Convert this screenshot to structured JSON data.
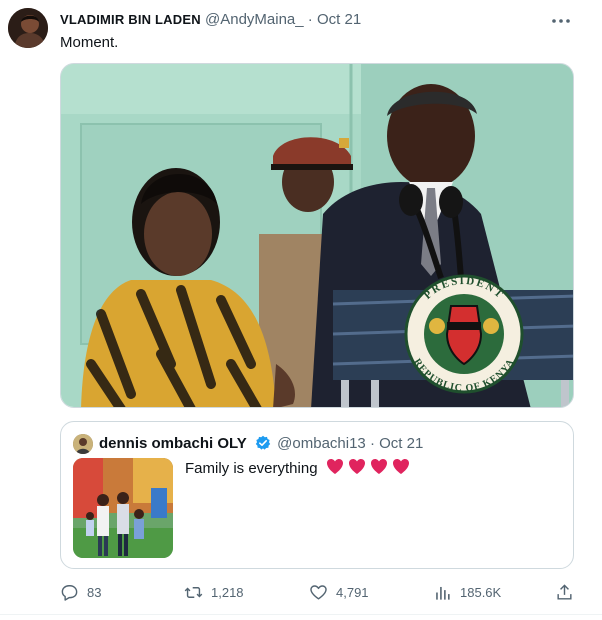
{
  "tweet": {
    "display_name": "VLADIMIR BIN LADEN",
    "handle": "@AndyMaina_",
    "separator": "·",
    "date": "Oct 21",
    "text": "Moment.",
    "more_icon": "more-horizontal-icon",
    "photo_seal_top": "PRESIDENT",
    "photo_seal_bottom": "REPUBLIC OF KENYA"
  },
  "quoted": {
    "display_name": "dennis ombachi OLY",
    "handle": "@ombachi13",
    "separator": "·",
    "date": "Oct 21",
    "text": "Family is everything",
    "emoji": "❤️❤️❤️❤️",
    "verified_color": "#1d9bf0"
  },
  "actions": {
    "replies": "83",
    "retweets": "1,218",
    "likes": "4,791",
    "views": "185.6K"
  },
  "colors": {
    "text": "#0f1419",
    "secondary": "#536471",
    "border": "#cfd9de",
    "heart": "#e0245e"
  }
}
